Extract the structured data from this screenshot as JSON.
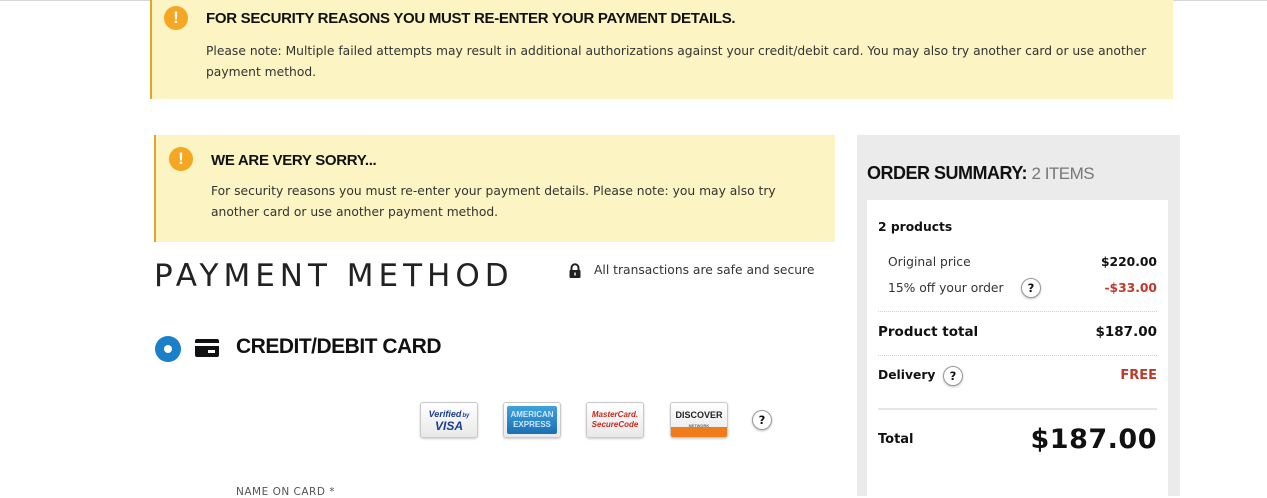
{
  "alerts": {
    "security": {
      "icon": "exclamation-icon",
      "title": "FOR SECURITY REASONS YOU MUST RE-ENTER YOUR PAYMENT DETAILS.",
      "text": "Please note: Multiple failed attempts may result in additional authorizations against your credit/debit card. You may also try another card or use another payment method."
    },
    "sorry": {
      "icon": "exclamation-icon",
      "title": "WE ARE VERY SORRY...",
      "text": "For security reasons you must re-enter your payment details. Please note: you may also try another card or use another payment method."
    }
  },
  "payment": {
    "title": "PAYMENT METHOD",
    "secure_text": "All transactions are safe and secure",
    "option": {
      "label": "CREDIT/DEBIT CARD",
      "selected": true
    },
    "card_logos": {
      "vbv": {
        "line1": "Verified",
        "line1b": "by",
        "line2": "VISA"
      },
      "amex": {
        "line1": "AMERICAN",
        "line2": "EXPRESS"
      },
      "mastercard": {
        "line1": "MasterCard.",
        "line2": "SecureCode"
      },
      "discover": {
        "line1": "DISCOVER",
        "line2": "NETWORK"
      }
    },
    "help_label": "?",
    "name_label": "NAME ON CARD *"
  },
  "summary": {
    "title_bold": "ORDER SUMMARY:",
    "title_light": "2 ITEMS",
    "products_label": "2 products",
    "original_price_label": "Original price",
    "original_price": "$220.00",
    "discount_label": "15% off your order",
    "discount": "-$33.00",
    "product_total_label": "Product total",
    "product_total": "$187.00",
    "delivery_label": "Delivery",
    "delivery": "FREE",
    "total_label": "Total",
    "total": "$187.00",
    "help_label": "?"
  },
  "colors": {
    "alert_bg": "#fcf4c3",
    "alert_border": "#e3a623",
    "warning_icon": "#f5a623",
    "radio_selected": "#1c7fc9",
    "discount_red": "#c0392b"
  }
}
